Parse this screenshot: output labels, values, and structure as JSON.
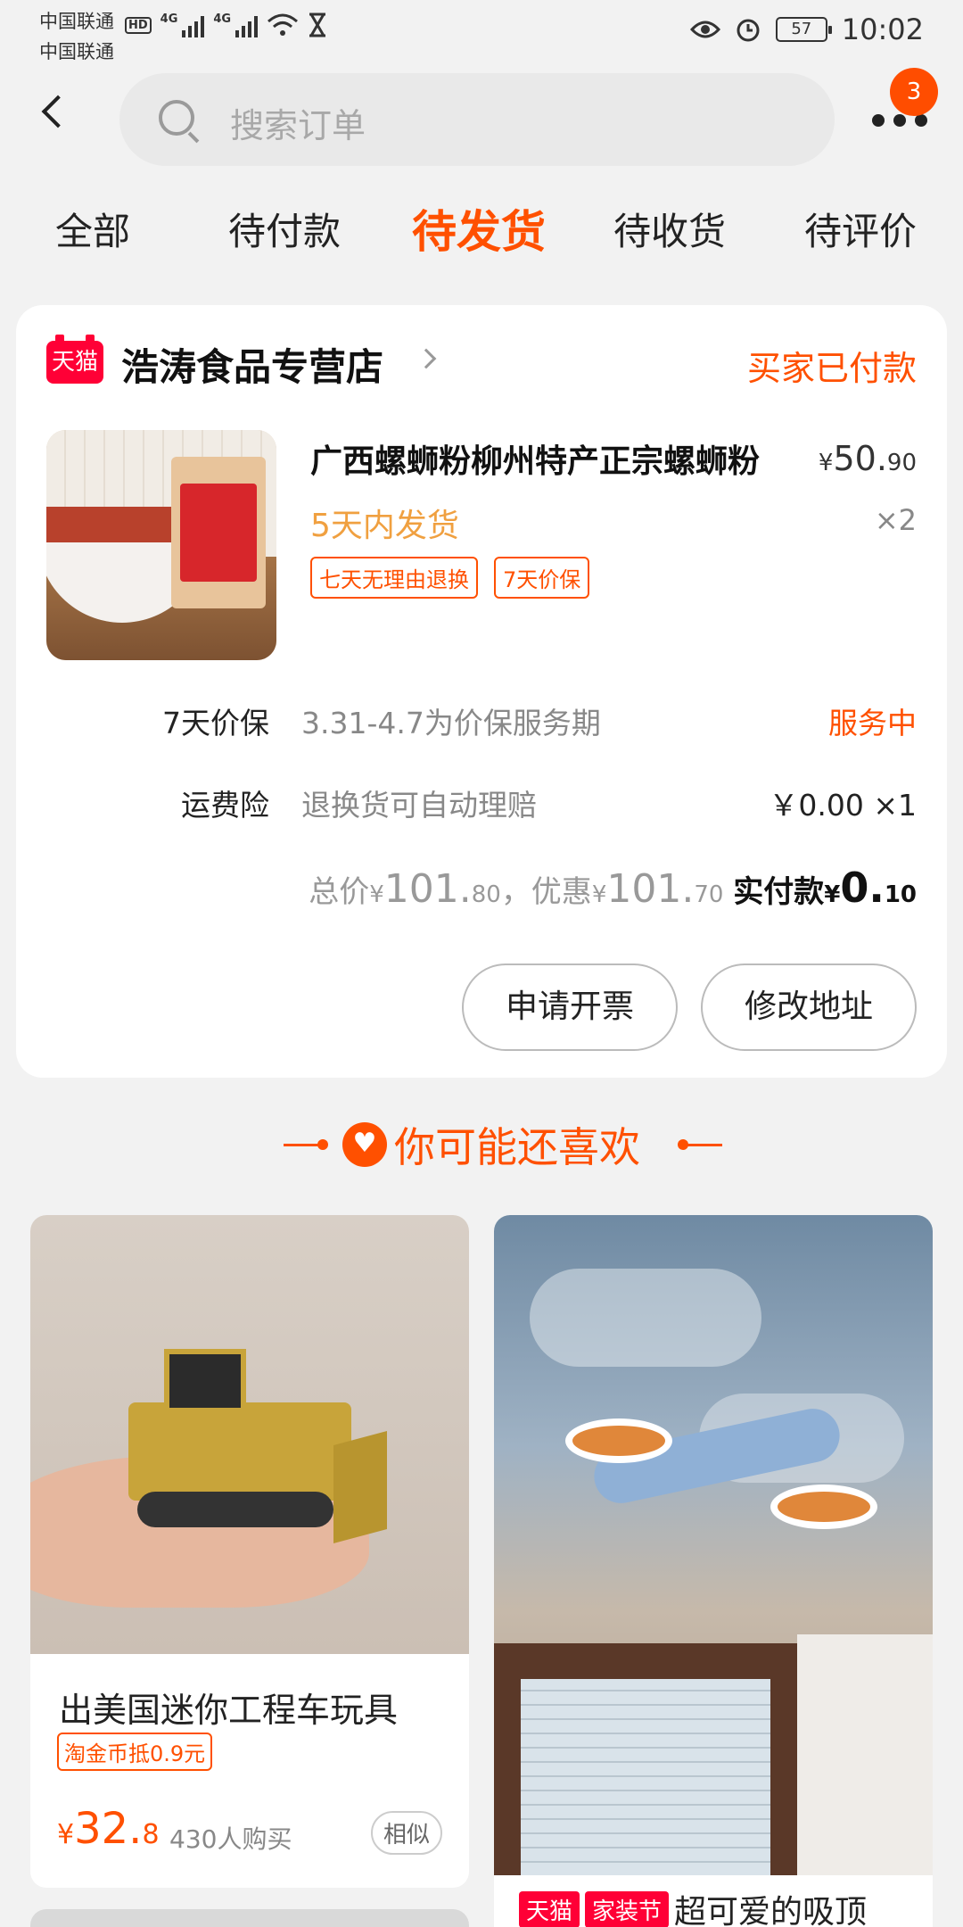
{
  "status_bar": {
    "carrier1": "中国联通",
    "carrier2": "中国联通",
    "hd": "HD",
    "net1": "4G",
    "net2": "4G",
    "battery": "57",
    "time": "10:02"
  },
  "header": {
    "search_placeholder": "搜索订单",
    "badge_count": "3"
  },
  "tabs": [
    {
      "label": "全部",
      "active": false
    },
    {
      "label": "待付款",
      "active": false
    },
    {
      "label": "待发货",
      "active": true
    },
    {
      "label": "待收货",
      "active": false
    },
    {
      "label": "待评价",
      "active": false
    }
  ],
  "order": {
    "shop_badge": "天猫",
    "shop_name": "浩涛食品专营店",
    "status": "买家已付款",
    "product": {
      "name": "广西螺蛳粉柳州特产正宗螺蛳粉",
      "price_symbol": "¥",
      "price_int": "50.",
      "price_dec": "90",
      "ship_note": "5天内发货",
      "qty": "×2",
      "tags": [
        "七天无理由退换",
        "7天价保"
      ]
    },
    "services": [
      {
        "label": "7天价保",
        "desc": "3.31-4.7为价保服务期",
        "value": "服务中"
      },
      {
        "label": "运费险",
        "desc": "退换货可自动理赔",
        "value": "￥0.00 ×1"
      }
    ],
    "totals": {
      "total_label": "总价",
      "total_int": "101.",
      "total_dec": "80",
      "discount_label": "，优惠",
      "discount_int": "101.",
      "discount_dec": "70",
      "paid_label": "实付款",
      "paid_int": "0.",
      "paid_dec": "10",
      "yen": "¥"
    },
    "buttons": {
      "invoice": "申请开票",
      "address": "修改地址"
    }
  },
  "recommend": {
    "title": "你可能还喜欢",
    "items": [
      {
        "title": "出美国迷你工程车玩具",
        "coin": "淘金币抵0.9元",
        "price_symbol": "¥",
        "price_int": "32.",
        "price_dec": "8",
        "sold": "430人购买",
        "similar": "相似"
      },
      {
        "tag1": "天猫",
        "tag2": "家装节",
        "title": "超可爱的吸顶"
      }
    ]
  }
}
